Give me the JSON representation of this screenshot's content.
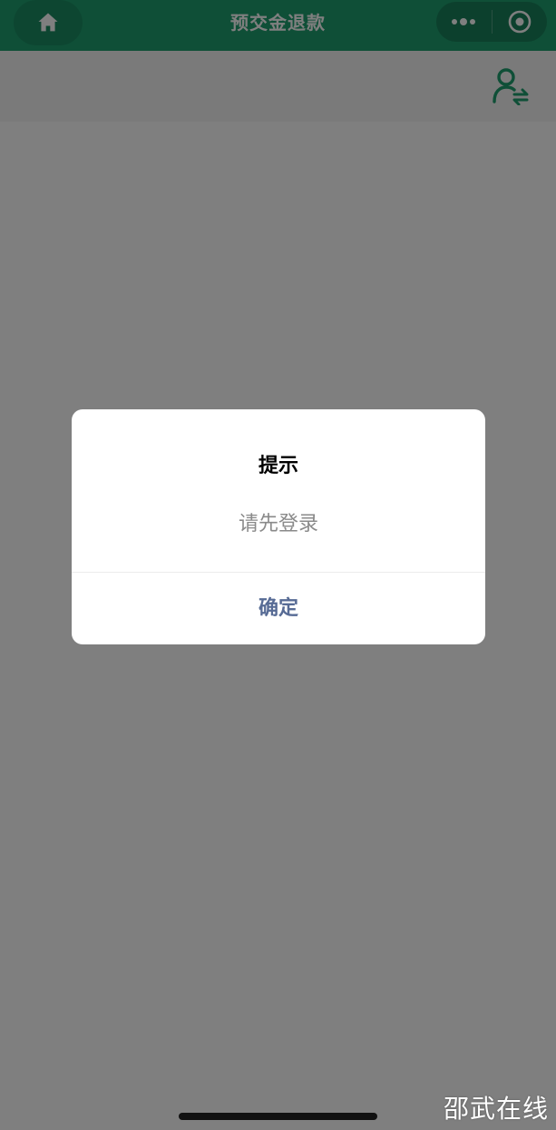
{
  "navbar": {
    "title": "预交金退款",
    "home_icon": "home-icon",
    "more_icon": "more-dots-icon",
    "close_icon": "capsule-close-icon",
    "color": "#1e9e6e"
  },
  "subheader": {
    "switch_user_icon": "switch-user-icon",
    "icon_color": "#1e9e6e"
  },
  "modal": {
    "title": "提示",
    "content": "请先登录",
    "confirm_label": "确定",
    "confirm_color": "#576b95"
  },
  "watermark": {
    "text": "邵武在线"
  }
}
